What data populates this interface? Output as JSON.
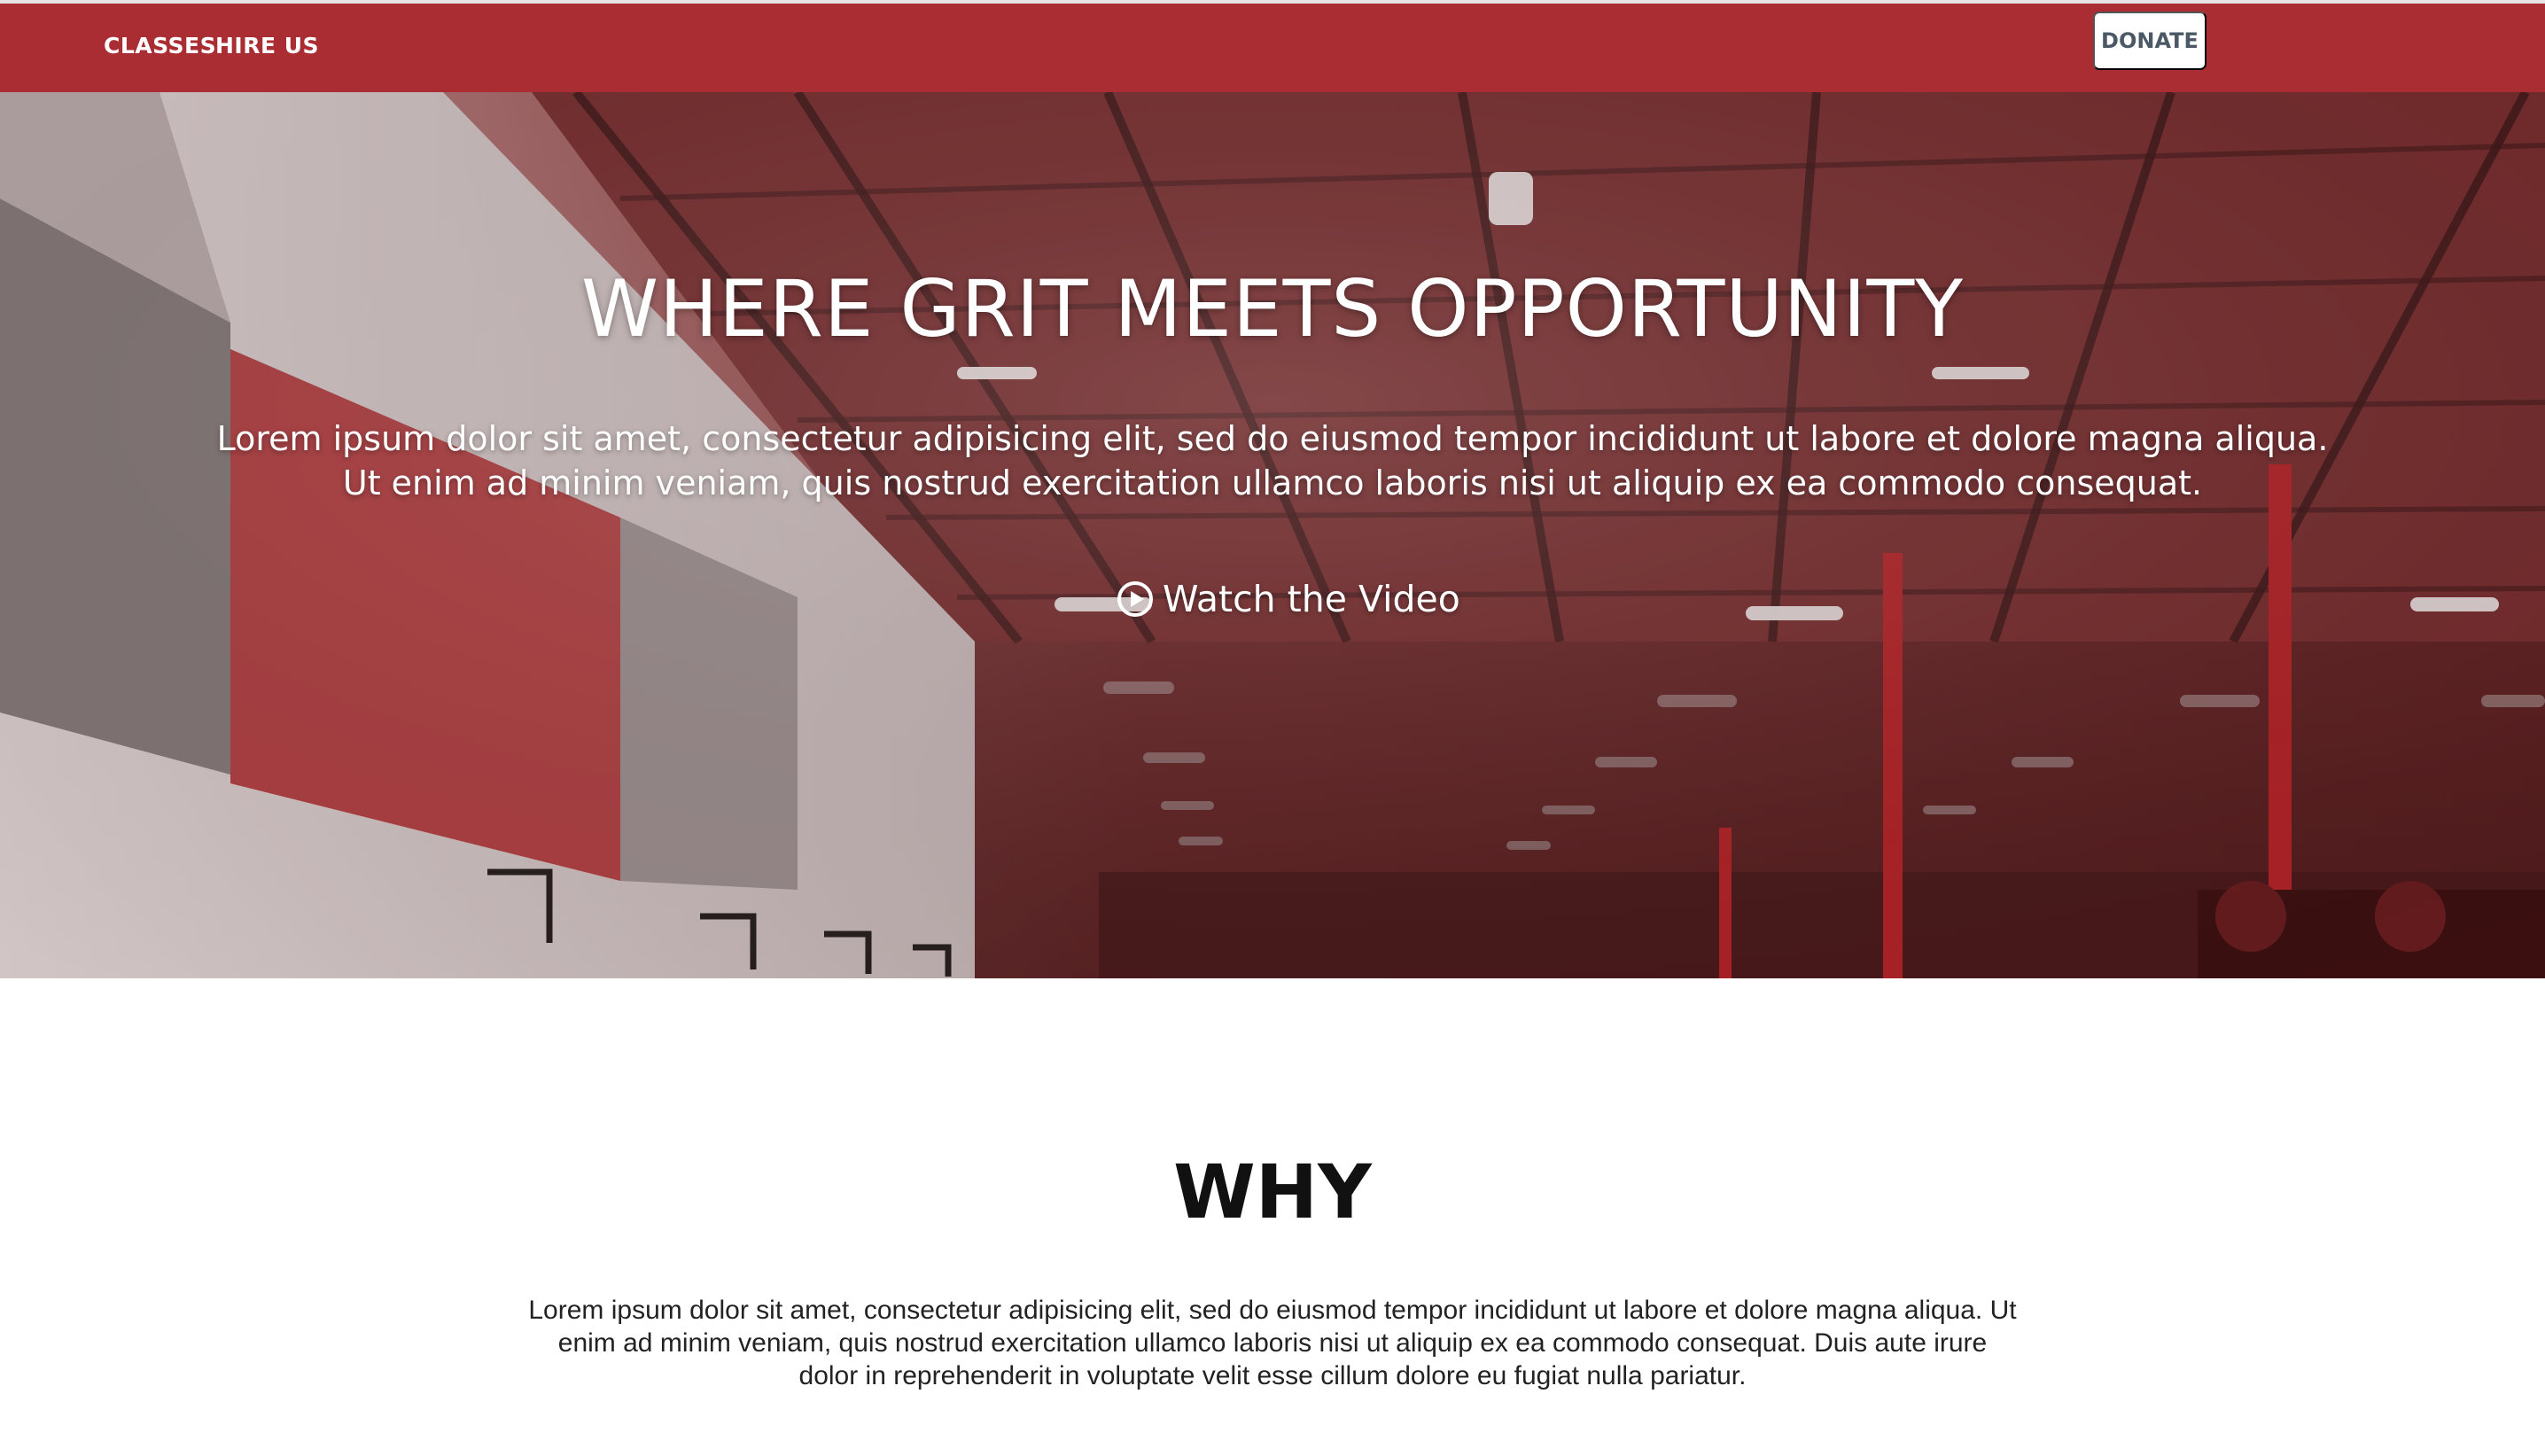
{
  "nav": {
    "classes": "CLASSES",
    "hire_us": "HIRE US",
    "donate": "DONATE"
  },
  "hero": {
    "title": "WHERE GRIT MEETS OPPORTUNITY",
    "text": "Lorem ipsum dolor sit amet, consectetur adipisicing elit, sed do eiusmod tempor incididunt ut labore et dolore magna aliqua. Ut enim ad minim veniam, quis nostrud exercitation ullamco laboris nisi ut aliquip ex ea commodo consequat.",
    "watch_label": "Watch the Video",
    "watch_icon": "play-circle-icon"
  },
  "why": {
    "title": "WHY",
    "text": "Lorem ipsum dolor sit amet, consectetur adipisicing elit, sed do eiusmod tempor incididunt ut labore et dolore magna aliqua. Ut enim ad minim veniam, quis nostrud exercitation ullamco laboris nisi ut aliquip ex ea commodo consequat. Duis aute irure dolor in reprehenderit in voluptate velit esse cillum dolore eu fugiat nulla pariatur."
  },
  "colors": {
    "brand_red": "#a92d32",
    "donate_text": "#4b5866",
    "white": "#ffffff"
  }
}
